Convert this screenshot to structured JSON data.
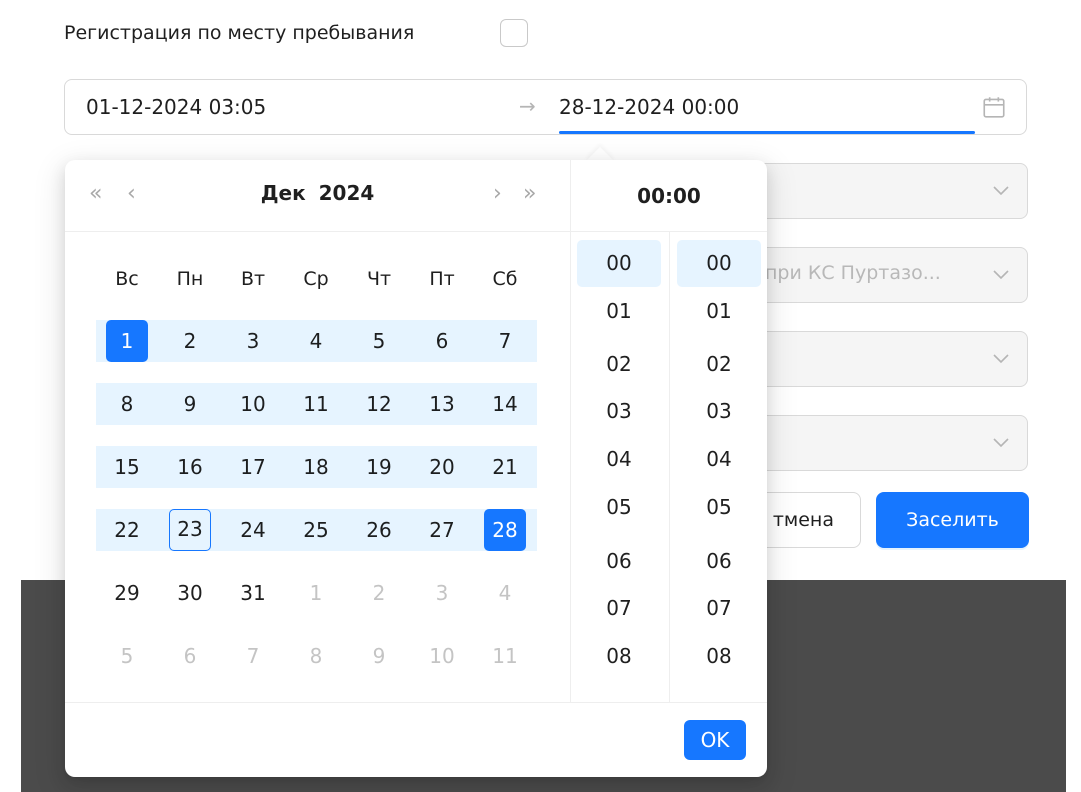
{
  "form": {
    "registration_label": "Регистрация по месту пребывания",
    "range_start": "01-12-2024 03:05",
    "range_arrow": "→",
    "range_end": "28-12-2024 00:00",
    "selects": [
      {
        "text": ""
      },
      {
        "text": "при КС Пуртазо..."
      },
      {
        "text": ""
      },
      {
        "text": ""
      }
    ],
    "cancel_label": "тмена",
    "submit_label": "Заселить"
  },
  "calendar": {
    "month": "Дек",
    "year": "2024",
    "nav": {
      "super_prev": "«",
      "prev": "‹",
      "next": "›",
      "super_next": "»"
    },
    "weekdays": [
      "Вс",
      "Пн",
      "Вт",
      "Ср",
      "Чт",
      "Пт",
      "Сб"
    ],
    "weeks": [
      [
        "1",
        "2",
        "3",
        "4",
        "5",
        "6",
        "7"
      ],
      [
        "8",
        "9",
        "10",
        "11",
        "12",
        "13",
        "14"
      ],
      [
        "15",
        "16",
        "17",
        "18",
        "19",
        "20",
        "21"
      ],
      [
        "22",
        "23",
        "24",
        "25",
        "26",
        "27",
        "28"
      ],
      [
        "29",
        "30",
        "31",
        "1",
        "2",
        "3",
        "4"
      ],
      [
        "5",
        "6",
        "7",
        "8",
        "9",
        "10",
        "11"
      ]
    ],
    "time_display": "00:00",
    "hours": [
      "00",
      "01",
      "02",
      "03",
      "04",
      "05",
      "06",
      "07",
      "08"
    ],
    "minutes": [
      "00",
      "01",
      "02",
      "03",
      "04",
      "05",
      "06",
      "07",
      "08"
    ],
    "ok_label": "OK"
  },
  "colors": {
    "primary": "#1677ff",
    "range_bg": "#e6f4ff",
    "overlay": "#4b4b4b"
  }
}
